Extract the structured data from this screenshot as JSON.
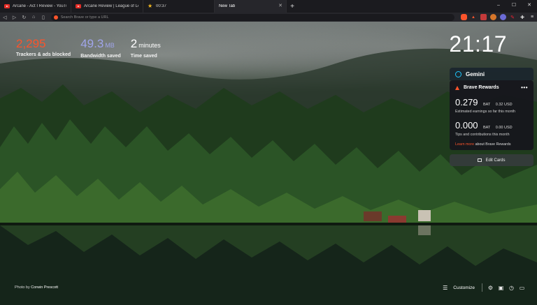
{
  "tabs": [
    {
      "title": "Arcane - Act I Review - YouTube",
      "favicon": "youtube-icon"
    },
    {
      "title": "Arcane Review | League of Legends -",
      "favicon": "youtube-icon"
    },
    {
      "title": "00:37",
      "favicon": "star-icon"
    },
    {
      "title": "New Tab",
      "favicon": "none"
    }
  ],
  "window_controls": {
    "minimize": "–",
    "maximize": "☐",
    "close": "✕"
  },
  "newtab_label": "+",
  "toolbar": {
    "placeholder": "Search Brave or type a URL"
  },
  "stats": {
    "trackers": {
      "value": "2,295",
      "label": "Trackers & ads blocked"
    },
    "bandwidth": {
      "value": "49.3",
      "unit": "MB",
      "label": "Bandwidth saved"
    },
    "time": {
      "value": "2",
      "unit": "minutes",
      "label": "Time saved"
    }
  },
  "clock": "21:17",
  "gemini": {
    "title": "Gemini"
  },
  "rewards": {
    "title": "Brave Rewards",
    "earnings": {
      "value": "0.279",
      "bat": "BAT",
      "usd": "0.32 USD",
      "desc": "Estimated earnings so far this month"
    },
    "tips": {
      "value": "0.000",
      "bat": "BAT",
      "usd": "0.00 USD",
      "desc": "Tips and contributions this month"
    },
    "learn_link": "Learn more",
    "learn_rest": " about Brave Rewards"
  },
  "edit_cards": "Edit Cards",
  "photo_credit": {
    "prefix": "Photo by ",
    "name": "Corwin Prescott"
  },
  "customize": "Customize",
  "colors": {
    "brand": "#fb542b",
    "bandwidth": "#a0a5eb",
    "gemini": "#1ec7ff"
  }
}
